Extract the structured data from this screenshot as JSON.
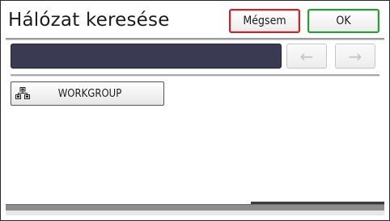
{
  "header": {
    "title": "Hálózat keresése",
    "cancel_label": "Mégsem",
    "ok_label": "OK"
  },
  "path_bar": {
    "value": "",
    "back_icon": "arrow-left-icon",
    "forward_icon": "arrow-right-icon",
    "back_glyph": "←",
    "forward_glyph": "→"
  },
  "network_list": {
    "items": [
      {
        "label": "WORKGROUP",
        "icon": "network-workgroup-icon"
      }
    ]
  },
  "colors": {
    "cancel_border": "#c1272d",
    "ok_border": "#2f9a3a",
    "path_bar_bg": "#3a3a52"
  }
}
